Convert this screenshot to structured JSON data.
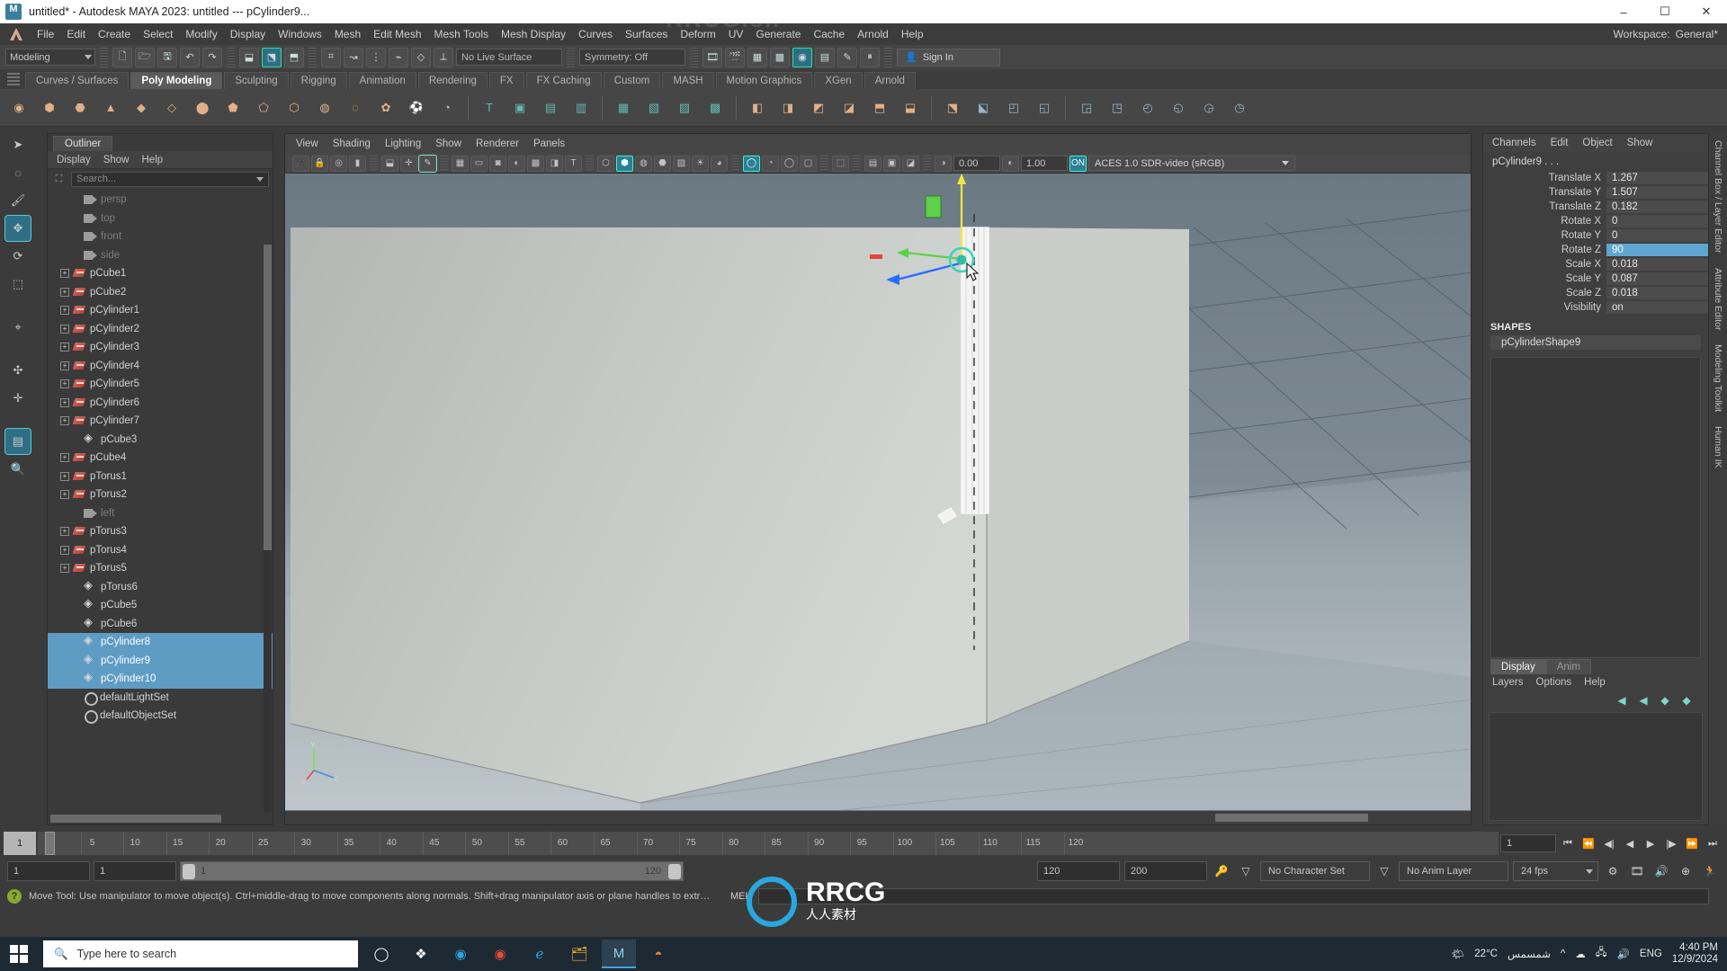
{
  "titlebar": {
    "title": "untitled* - Autodesk MAYA 2023: untitled   ---   pCylinder9...",
    "minimize": "–",
    "maximize": "☐",
    "close": "✕"
  },
  "menubar": {
    "items": [
      "File",
      "Edit",
      "Create",
      "Select",
      "Modify",
      "Display",
      "Windows",
      "Mesh",
      "Edit Mesh",
      "Mesh Tools",
      "Mesh Display",
      "Curves",
      "Surfaces",
      "Deform",
      "UV",
      "Generate",
      "Cache",
      "Arnold",
      "Help"
    ],
    "workspace_label": "Workspace:",
    "workspace_value": "General*"
  },
  "statusline": {
    "menuset": "Modeling",
    "live_surface": "No Live Surface",
    "symmetry": "Symmetry: Off",
    "signin": "Sign In",
    "icons": [
      "new-scene-icon",
      "open-scene-icon",
      "save-scene-icon",
      "undo-icon",
      "redo-icon",
      "select-hierarchy-icon",
      "select-object-icon",
      "select-component-icon",
      "snap-grid-icon",
      "snap-curve-icon",
      "snap-point-icon",
      "snap-projected-icon",
      "snap-view-plane-icon",
      "make-live-icon",
      "render-current-frame-icon",
      "ipr-render-icon",
      "render-settings-icon",
      "hypershade-icon",
      "render-view-icon",
      "playblast-icon",
      "pause-icon"
    ]
  },
  "shelf": {
    "tabs": [
      "Curves / Surfaces",
      "Poly Modeling",
      "Sculpting",
      "Rigging",
      "Animation",
      "Rendering",
      "FX",
      "FX Caching",
      "Custom",
      "MASH",
      "Motion Graphics",
      "XGen",
      "Arnold"
    ],
    "active_tab": "Poly Modeling",
    "icons": [
      "poly-sphere-icon",
      "poly-cube-icon",
      "poly-cylinder-icon",
      "poly-cone-icon",
      "poly-torus-icon",
      "poly-plane-icon",
      "poly-disc-icon",
      "poly-platonic-icon",
      "poly-pyramid-icon",
      "poly-prism-icon",
      "poly-pipe-icon",
      "poly-helix-icon",
      "poly-gear-icon",
      "poly-soccer-icon",
      "poly-super-ellipse-icon",
      "text-icon",
      "svg-icon",
      "poly-type-icon",
      "sweep-mesh-icon",
      "combine-icon",
      "separate-icon",
      "booleans-icon",
      "smooth-icon",
      "extrude-icon",
      "bevel-icon",
      "bridge-icon",
      "mirror-icon",
      "fill-hole-icon",
      "reduce-icon",
      "multi-cut-icon",
      "target-weld-icon",
      "quad-draw-icon",
      "crease-icon",
      "sculpt-icon",
      "append-polygon-icon",
      "insert-edge-loop-icon",
      "offset-edge-loop-icon",
      "slide-edge-icon",
      "delete-edge-icon"
    ]
  },
  "toolbox": {
    "tools": [
      "select-tool",
      "lasso-select-tool",
      "paint-select-tool",
      "move-tool",
      "rotate-tool",
      "scale-tool",
      "last-tool-used",
      "snap-together-tool",
      "show-manipulator-tool",
      "transform-component-tool",
      "zoom-tool"
    ],
    "active_tool": "move-tool",
    "badge": "M"
  },
  "outliner": {
    "tab": "Outliner",
    "menu": [
      "Display",
      "Show",
      "Help"
    ],
    "search_placeholder": "Search...",
    "items": [
      {
        "label": "persp",
        "type": "camera",
        "indent": 1,
        "expandable": false,
        "selected": false,
        "dim": true
      },
      {
        "label": "top",
        "type": "camera",
        "indent": 1,
        "expandable": false,
        "selected": false,
        "dim": true
      },
      {
        "label": "front",
        "type": "camera",
        "indent": 1,
        "expandable": false,
        "selected": false,
        "dim": true
      },
      {
        "label": "side",
        "type": "camera",
        "indent": 1,
        "expandable": false,
        "selected": false,
        "dim": true
      },
      {
        "label": "pCube1",
        "type": "mesh",
        "indent": 0,
        "expandable": true,
        "selected": false,
        "dim": false
      },
      {
        "label": "pCube2",
        "type": "mesh",
        "indent": 0,
        "expandable": true,
        "selected": false,
        "dim": false
      },
      {
        "label": "pCylinder1",
        "type": "mesh",
        "indent": 0,
        "expandable": true,
        "selected": false,
        "dim": false
      },
      {
        "label": "pCylinder2",
        "type": "mesh",
        "indent": 0,
        "expandable": true,
        "selected": false,
        "dim": false
      },
      {
        "label": "pCylinder3",
        "type": "mesh",
        "indent": 0,
        "expandable": true,
        "selected": false,
        "dim": false
      },
      {
        "label": "pCylinder4",
        "type": "mesh",
        "indent": 0,
        "expandable": true,
        "selected": false,
        "dim": false
      },
      {
        "label": "pCylinder5",
        "type": "mesh",
        "indent": 0,
        "expandable": true,
        "selected": false,
        "dim": false
      },
      {
        "label": "pCylinder6",
        "type": "mesh",
        "indent": 0,
        "expandable": true,
        "selected": false,
        "dim": false
      },
      {
        "label": "pCylinder7",
        "type": "mesh",
        "indent": 0,
        "expandable": true,
        "selected": false,
        "dim": false
      },
      {
        "label": "pCube3",
        "type": "poly",
        "indent": 1,
        "expandable": false,
        "selected": false,
        "dim": false
      },
      {
        "label": "pCube4",
        "type": "mesh",
        "indent": 0,
        "expandable": true,
        "selected": false,
        "dim": false
      },
      {
        "label": "pTorus1",
        "type": "mesh",
        "indent": 0,
        "expandable": true,
        "selected": false,
        "dim": false
      },
      {
        "label": "pTorus2",
        "type": "mesh",
        "indent": 0,
        "expandable": true,
        "selected": false,
        "dim": false
      },
      {
        "label": "left",
        "type": "camera",
        "indent": 1,
        "expandable": false,
        "selected": false,
        "dim": true
      },
      {
        "label": "pTorus3",
        "type": "mesh",
        "indent": 0,
        "expandable": true,
        "selected": false,
        "dim": false
      },
      {
        "label": "pTorus4",
        "type": "mesh",
        "indent": 0,
        "expandable": true,
        "selected": false,
        "dim": false
      },
      {
        "label": "pTorus5",
        "type": "mesh",
        "indent": 0,
        "expandable": true,
        "selected": false,
        "dim": false
      },
      {
        "label": "pTorus6",
        "type": "poly",
        "indent": 1,
        "expandable": false,
        "selected": false,
        "dim": false
      },
      {
        "label": "pCube5",
        "type": "poly",
        "indent": 1,
        "expandable": false,
        "selected": false,
        "dim": false
      },
      {
        "label": "pCube6",
        "type": "poly",
        "indent": 1,
        "expandable": false,
        "selected": false,
        "dim": false
      },
      {
        "label": "pCylinder8",
        "type": "poly",
        "indent": 1,
        "expandable": false,
        "selected": true,
        "dim": false
      },
      {
        "label": "pCylinder9",
        "type": "poly",
        "indent": 1,
        "expandable": false,
        "selected": true,
        "dim": false
      },
      {
        "label": "pCylinder10",
        "type": "poly",
        "indent": 1,
        "expandable": false,
        "selected": true,
        "dim": false
      },
      {
        "label": "defaultLightSet",
        "type": "set",
        "indent": 1,
        "expandable": false,
        "selected": false,
        "dim": false
      },
      {
        "label": "defaultObjectSet",
        "type": "set",
        "indent": 1,
        "expandable": false,
        "selected": false,
        "dim": false
      }
    ]
  },
  "viewport": {
    "menu": [
      "View",
      "Shading",
      "Lighting",
      "Show",
      "Renderer",
      "Panels"
    ],
    "exposure": "0.00",
    "gamma": "1.00",
    "color_profile": "ACES 1.0 SDR-video (sRGB)",
    "axis_labels": {
      "y": "Y",
      "x": "X",
      "z": "Z"
    }
  },
  "channelbox": {
    "menu": [
      "Channels",
      "Edit",
      "Object",
      "Show"
    ],
    "object_name": "pCylinder9 . . .",
    "attributes": [
      {
        "label": "Translate X",
        "value": "1.267",
        "highlight": false
      },
      {
        "label": "Translate Y",
        "value": "1.507",
        "highlight": false
      },
      {
        "label": "Translate Z",
        "value": "0.182",
        "highlight": false
      },
      {
        "label": "Rotate X",
        "value": "0",
        "highlight": false
      },
      {
        "label": "Rotate Y",
        "value": "0",
        "highlight": false
      },
      {
        "label": "Rotate Z",
        "value": "90",
        "highlight": true
      },
      {
        "label": "Scale X",
        "value": "0.018",
        "highlight": false
      },
      {
        "label": "Scale Y",
        "value": "0.087",
        "highlight": false
      },
      {
        "label": "Scale Z",
        "value": "0.018",
        "highlight": false
      },
      {
        "label": "Visibility",
        "value": "on",
        "highlight": false
      }
    ],
    "shapes_header": "SHAPES",
    "shape_name": "pCylinderShape9"
  },
  "layer_panel": {
    "tabs": [
      "Display",
      "Anim"
    ],
    "active_tab": "Display",
    "menu": [
      "Layers",
      "Options",
      "Help"
    ],
    "buttons": [
      "move-layer-up-icon",
      "move-layer-down-icon",
      "new-layer-icon",
      "new-layer-from-selection-icon"
    ]
  },
  "right_tabs": [
    "Channel Box / Layer Editor",
    "Attribute Editor",
    "Modeling Toolkit",
    "Human IK"
  ],
  "timeslider": {
    "current_frame": "1",
    "ticks": [
      5,
      10,
      15,
      20,
      25,
      30,
      35,
      40,
      45,
      50,
      55,
      60,
      65,
      70,
      75,
      80,
      85,
      90,
      95,
      100,
      105,
      110,
      115,
      120
    ],
    "start_field": "1",
    "playback_start": "1",
    "range_start": "1",
    "range_end": "120",
    "anim_end": "120",
    "playback_end": "200",
    "character_set": "No Character Set",
    "anim_layer": "No Anim Layer",
    "fps": "24 fps",
    "transport": [
      "go-to-start-icon",
      "step-back-key-icon",
      "step-back-frame-icon",
      "play-backwards-icon",
      "play-forwards-icon",
      "step-forward-frame-icon",
      "step-forward-key-icon",
      "go-to-end-icon"
    ]
  },
  "helpline": {
    "message": "Move Tool: Use manipulator to move object(s). Ctrl+middle-drag to move components along normals. Shift+drag manipulator axis or plane handles to extrude components or c",
    "command_label": "MEL"
  },
  "taskbar": {
    "search_placeholder": "Type here to search",
    "apps": [
      "cortana-icon",
      "task-view-icon",
      "edge-icon",
      "chrome-icon",
      "internet-explorer-icon",
      "file-explorer-icon",
      "maya-icon",
      "blender-icon"
    ],
    "weather_temp": "22°C",
    "weather_text": "شمسمس",
    "tray": [
      "show-hidden-icons-icon",
      "onedrive-icon",
      "network-icon",
      "volume-icon"
    ],
    "language": "ENG",
    "time": "4:40 PM",
    "date": "12/9/2024"
  },
  "watermark": {
    "brand": "RRCG",
    "sub": "人人素材",
    "tile": "RRCG.cn"
  },
  "colors": {
    "selection_blue": "#5e9cc4",
    "accent_teal": "#2d7f93",
    "maya_bg": "#3b3b3b",
    "panel_bg": "#3f3f3f",
    "viewport_sky": "#6e7c86"
  }
}
